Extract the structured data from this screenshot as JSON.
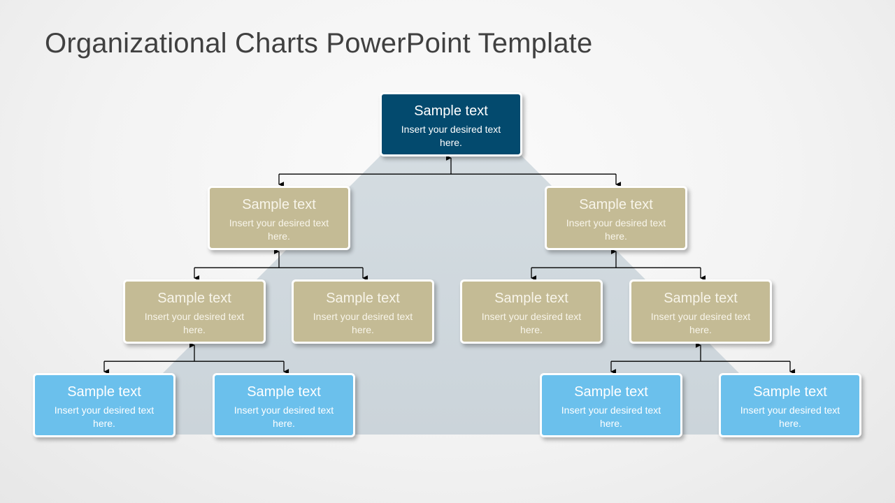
{
  "slide": {
    "title": "Organizational Charts PowerPoint Template"
  },
  "colors": {
    "level1": "#034a6e",
    "level2": "#c4bb95",
    "level3": "#c4bb95",
    "level4": "#6bc0ec",
    "pyramid": "#cfd7dd",
    "connector": "#000000"
  },
  "nodes": {
    "root": {
      "title": "Sample text",
      "body": "Insert your desired text here."
    },
    "l2_left": {
      "title": "Sample text",
      "body": "Insert your desired text here."
    },
    "l2_right": {
      "title": "Sample text",
      "body": "Insert your desired text here."
    },
    "l3_1": {
      "title": "Sample text",
      "body": "Insert your desired text here."
    },
    "l3_2": {
      "title": "Sample text",
      "body": "Insert your desired text here."
    },
    "l3_3": {
      "title": "Sample text",
      "body": "Insert your desired text here."
    },
    "l3_4": {
      "title": "Sample text",
      "body": "Insert your desired text here."
    },
    "l4_1": {
      "title": "Sample text",
      "body": "Insert your desired text here."
    },
    "l4_2": {
      "title": "Sample text",
      "body": "Insert your desired text here."
    },
    "l4_3": {
      "title": "Sample text",
      "body": "Insert your desired text here."
    },
    "l4_4": {
      "title": "Sample text",
      "body": "Insert your desired text here."
    }
  },
  "edges": [
    [
      "root",
      "l2_left"
    ],
    [
      "root",
      "l2_right"
    ],
    [
      "l2_left",
      "l3_1"
    ],
    [
      "l2_left",
      "l3_2"
    ],
    [
      "l2_right",
      "l3_3"
    ],
    [
      "l2_right",
      "l3_4"
    ],
    [
      "l3_1",
      "l4_1"
    ],
    [
      "l3_1",
      "l4_2"
    ],
    [
      "l3_4",
      "l4_3"
    ],
    [
      "l3_4",
      "l4_4"
    ]
  ]
}
